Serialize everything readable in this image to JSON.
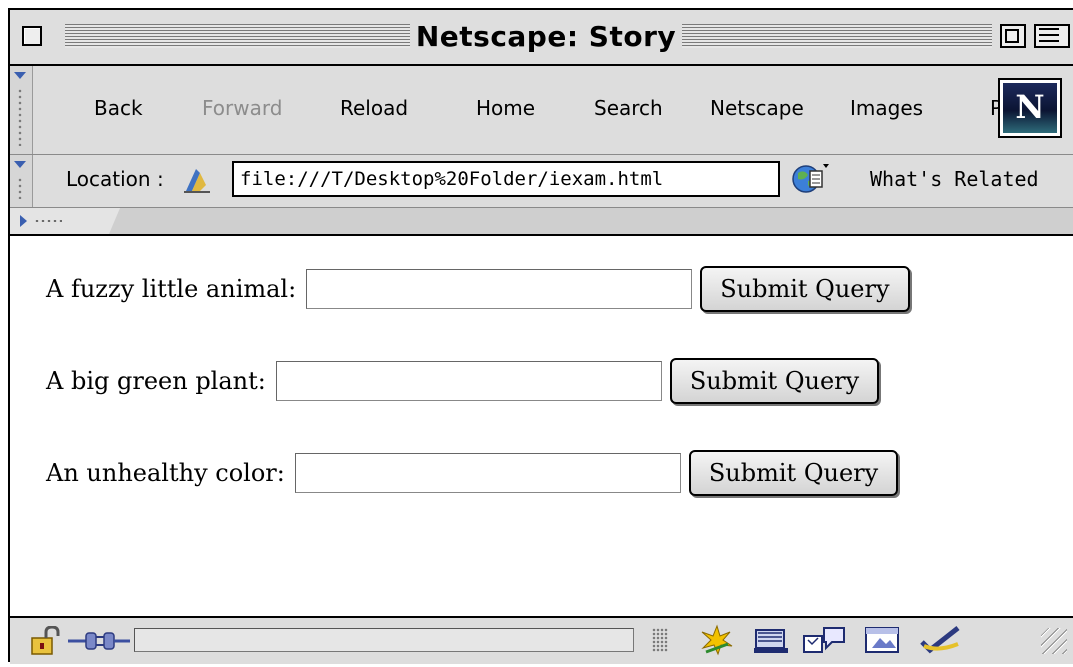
{
  "window": {
    "title": "Netscape: Story"
  },
  "nav_toolbar": {
    "buttons": [
      {
        "label": "Back",
        "enabled": true
      },
      {
        "label": "Forward",
        "enabled": false
      },
      {
        "label": "Reload",
        "enabled": true
      },
      {
        "label": "Home",
        "enabled": true
      },
      {
        "label": "Search",
        "enabled": true
      },
      {
        "label": "Netscape",
        "enabled": true
      },
      {
        "label": "Images",
        "enabled": true
      },
      {
        "label": "P",
        "enabled": true
      }
    ],
    "logo_letter": "N"
  },
  "location_bar": {
    "label": "Location :",
    "url": "file:///T/Desktop%20Folder/iexam.html",
    "related_label": "What's Related"
  },
  "form": {
    "rows": [
      {
        "label": "A fuzzy little animal:",
        "value": "",
        "button": "Submit Query"
      },
      {
        "label": "A big green plant:",
        "value": "",
        "button": "Submit Query"
      },
      {
        "label": "An unhealthy color:",
        "value": "",
        "button": "Submit Query"
      }
    ]
  },
  "status_bar": {
    "progress_fraction": 0.0
  },
  "colors": {
    "chrome": "#dddddd",
    "accent_blue": "#3a5fb0"
  }
}
